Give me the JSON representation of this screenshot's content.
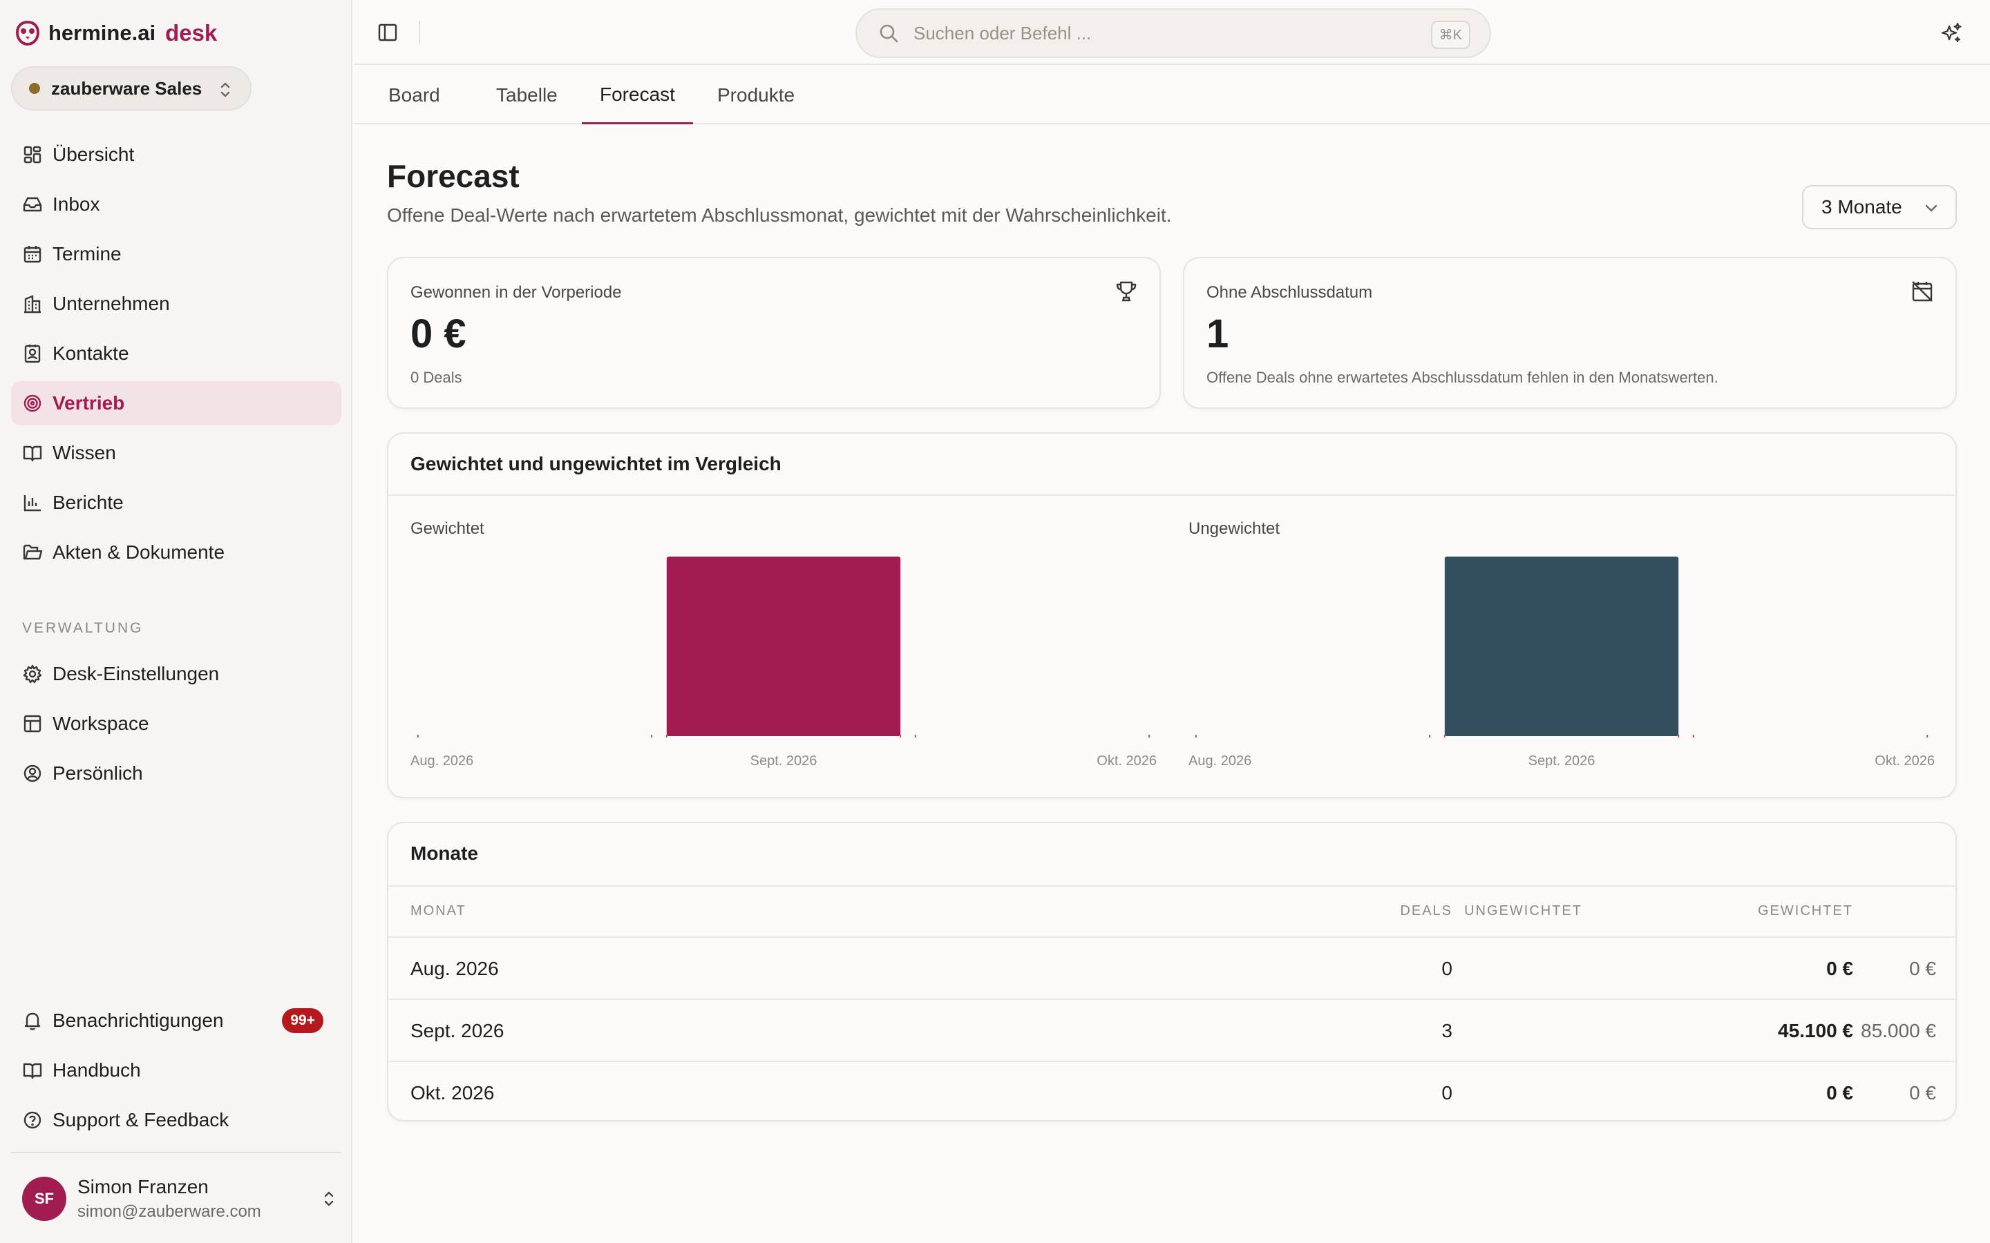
{
  "brand": {
    "name": "hermine.ai",
    "suffix": "desk"
  },
  "workspace": {
    "name": "zauberware Sales"
  },
  "nav": {
    "items": [
      {
        "label": "Übersicht",
        "icon": "dashboard-icon"
      },
      {
        "label": "Inbox",
        "icon": "inbox-icon"
      },
      {
        "label": "Termine",
        "icon": "calendar-icon"
      },
      {
        "label": "Unternehmen",
        "icon": "building-icon"
      },
      {
        "label": "Kontakte",
        "icon": "contact-icon"
      },
      {
        "label": "Vertrieb",
        "icon": "target-icon",
        "active": true
      },
      {
        "label": "Wissen",
        "icon": "book-icon"
      },
      {
        "label": "Berichte",
        "icon": "bar-chart-icon"
      },
      {
        "label": "Akten & Dokumente",
        "icon": "folder-icon"
      }
    ],
    "section_label": "VERWALTUNG",
    "admin_items": [
      {
        "label": "Desk-Einstellungen",
        "icon": "gear-icon"
      },
      {
        "label": "Workspace",
        "icon": "layout-icon"
      },
      {
        "label": "Persönlich",
        "icon": "user-circle-icon"
      }
    ],
    "bottom_items": [
      {
        "label": "Benachrichtigungen",
        "icon": "bell-icon",
        "badge": "99+"
      },
      {
        "label": "Handbuch",
        "icon": "book-icon"
      },
      {
        "label": "Support & Feedback",
        "icon": "help-icon"
      }
    ]
  },
  "user": {
    "initials": "SF",
    "name": "Simon Franzen",
    "email": "simon@zauberware.com"
  },
  "search": {
    "placeholder": "Suchen oder Befehl ...",
    "shortcut": "⌘K"
  },
  "tabs": [
    {
      "label": "Board"
    },
    {
      "label": "Tabelle"
    },
    {
      "label": "Forecast",
      "active": true
    },
    {
      "label": "Produkte"
    }
  ],
  "page": {
    "title": "Forecast",
    "subtitle": "Offene Deal-Werte nach erwartetem Abschlussmonat, gewichtet mit der Wahrscheinlichkeit.",
    "range_select": "3 Monate"
  },
  "kpis": [
    {
      "label": "Gewonnen in der Vorperiode",
      "value": "0 €",
      "note": "0 Deals",
      "icon": "trophy-icon"
    },
    {
      "label": "Ohne Abschlussdatum",
      "value": "1",
      "note": "Offene Deals ohne erwartetes Abschlussdatum fehlen in den Monatswerten.",
      "icon": "calendar-off-icon"
    }
  ],
  "comparison": {
    "title": "Gewichtet und ungewichtet im Vergleich"
  },
  "colors": {
    "accent": "#a11c50",
    "weighted_bar": "#a11c50",
    "unweighted_bar": "#334f5d"
  },
  "chart_data": [
    {
      "type": "bar",
      "title": "Gewichtet",
      "categories": [
        "Aug. 2026",
        "Sept. 2026",
        "Okt. 2026"
      ],
      "values": [
        0,
        45100,
        0
      ],
      "unit": "€"
    },
    {
      "type": "bar",
      "title": "Ungewichtet",
      "categories": [
        "Aug. 2026",
        "Sept. 2026",
        "Okt. 2026"
      ],
      "values": [
        0,
        85000,
        0
      ],
      "unit": "€"
    }
  ],
  "months_table": {
    "title": "Monate",
    "headers": [
      "MONAT",
      "DEALS",
      "GEWICHTET",
      "UNGEWICHTET"
    ],
    "rows": [
      {
        "month": "Aug. 2026",
        "deals": "0",
        "weighted": "0 €",
        "unweighted": "0 €"
      },
      {
        "month": "Sept. 2026",
        "deals": "3",
        "weighted": "45.100 €",
        "unweighted": "85.000 €"
      },
      {
        "month": "Okt. 2026",
        "deals": "0",
        "weighted": "0 €",
        "unweighted": "0 €"
      }
    ]
  }
}
